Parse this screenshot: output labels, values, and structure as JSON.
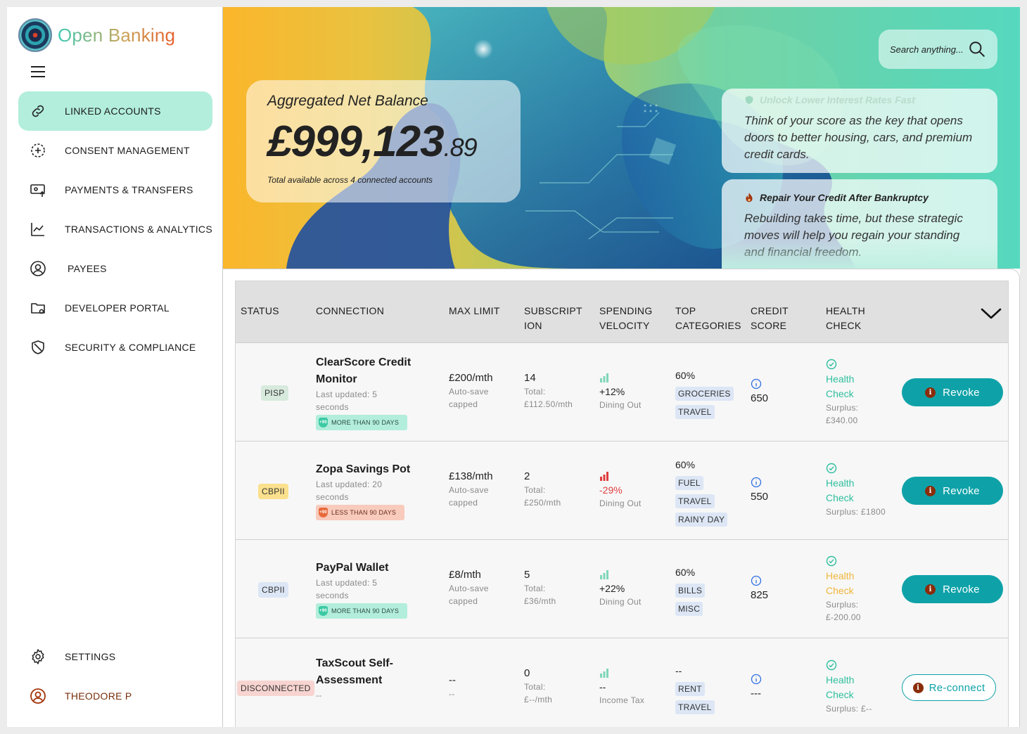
{
  "brand": {
    "name": "Open Banking"
  },
  "sidebar": {
    "items": [
      {
        "label": "LINKED ACCOUNTS",
        "icon": "link-icon",
        "active": true
      },
      {
        "label": "CONSENT MANAGEMENT",
        "icon": "consent-icon"
      },
      {
        "label": "PAYMENTS & TRANSFERS",
        "icon": "payments-icon"
      },
      {
        "label": "TRANSACTIONS & ANALYTICS",
        "icon": "analytics-icon"
      },
      {
        "label": "PAYEES",
        "icon": "payee-icon"
      },
      {
        "label": "DEVELOPER PORTAL",
        "icon": "folder-icon"
      },
      {
        "label": "SECURITY & COMPLIANCE",
        "icon": "shield-icon"
      }
    ],
    "settings_label": "SETTINGS",
    "user_label": "THEODORE P"
  },
  "hero": {
    "balance_label": "Aggregated Net Balance",
    "balance_main": "£999,123",
    "balance_cents": ".89",
    "balance_sub": "Total available across 4 connected accounts",
    "search_placeholder": "Search anything...",
    "tips": [
      {
        "title": "Unlock Lower Interest Rates Fast",
        "body": "Think of your score as the key that opens doors to better housing, cars, and premium credit cards."
      },
      {
        "title": "Repair Your Credit After Bankruptcy",
        "body": "Rebuilding takes time, but these strategic moves will help you regain your standing and financial freedom."
      }
    ]
  },
  "table": {
    "headers": {
      "status": "STATUS",
      "connection": "CONNECTION",
      "max_limit": "MAX LIMIT",
      "subscription_1": "SUBSCRIPT",
      "subscription_2": "ION",
      "spending_1": "SPENDING",
      "spending_2": "VELOCITY",
      "top_1": "TOP",
      "top_2": "CATEGORIES",
      "credit_1": "CREDIT",
      "credit_2": "SCORE",
      "health_1": "HEALTH",
      "health_2": "CHECK"
    },
    "rows": [
      {
        "status": "PISP",
        "name_1": "ClearScore Credit",
        "name_2": "Monitor",
        "updated_1": "Last updated: 5",
        "updated_2": "seconds",
        "badge": "MORE THAN 90 DAYS",
        "badge_icon": "+90",
        "limit": "£200/mth",
        "limit_sub_1": "Auto-save",
        "limit_sub_2": "capped",
        "subs_count": "14",
        "subs_total_1": "Total:",
        "subs_total_2": "£112.50/mth",
        "velocity": "+12%",
        "velocity_sub": "Dining Out",
        "top_pct": "60%",
        "categories": [
          "GROCERIES",
          "TRAVEL"
        ],
        "score": "650",
        "health_1": "Health",
        "health_2": "Check",
        "surplus_1": "Surplus:",
        "surplus_2": "£340.00",
        "action": "Revoke"
      },
      {
        "status": "CBPII",
        "name_1": "Zopa Savings Pot",
        "updated_1": "Last updated: 20",
        "updated_2": "seconds",
        "badge": "LESS THAN 90 DAYS",
        "badge_icon": "+90",
        "limit": "£138/mth",
        "limit_sub_1": "Auto-save",
        "limit_sub_2": "capped",
        "subs_count": "2",
        "subs_total_1": "Total:",
        "subs_total_2": "£250/mth",
        "velocity": "-29%",
        "velocity_sub": "Dining Out",
        "top_pct": "60%",
        "categories": [
          "FUEL",
          "TRAVEL",
          "RAINY DAY"
        ],
        "score": "550",
        "health_1": "Health",
        "health_2": "Check",
        "surplus_1": "Surplus: £1800",
        "action": "Revoke"
      },
      {
        "status": "CBPII",
        "name_1": "PayPal Wallet",
        "updated_1": "Last updated: 5",
        "updated_2": "seconds",
        "badge": "MORE THAN 90 DAYS",
        "badge_icon": "+90",
        "limit": "£8/mth",
        "limit_sub_1": "Auto-save",
        "limit_sub_2": "capped",
        "subs_count": "5",
        "subs_total_1": "Total:",
        "subs_total_2": "£36/mth",
        "velocity": "+22%",
        "velocity_sub": "Dining Out",
        "top_pct": "60%",
        "categories": [
          "BILLS",
          "MISC"
        ],
        "score": "825",
        "health_1": "Health",
        "health_2": "Check",
        "surplus_1": "Surplus:",
        "surplus_2": "£-200.00",
        "action": "Revoke"
      },
      {
        "status": "DISCONNECTED",
        "name_1": "TaxScout Self-",
        "name_2": "Assessment",
        "updated_1": "--",
        "limit": "--",
        "limit_sub_1": "--",
        "subs_count": "0",
        "subs_total_1": "Total:",
        "subs_total_2": "£--/mth",
        "velocity": "--",
        "velocity_sub": "Income Tax",
        "top_pct": "--",
        "categories": [
          "RENT",
          "TRAVEL"
        ],
        "score": "---",
        "health_1": "Health",
        "health_2": "Check",
        "surplus_1": "Surplus: £--",
        "action": "Re-connect"
      }
    ]
  },
  "colors": {
    "accent": "#0ea2a8",
    "active_nav": "#b2eedb",
    "health_good": "#2fbf9e",
    "health_warn": "#f0b63c",
    "negative": "#e03e3e",
    "user": "#7a2e0a"
  }
}
